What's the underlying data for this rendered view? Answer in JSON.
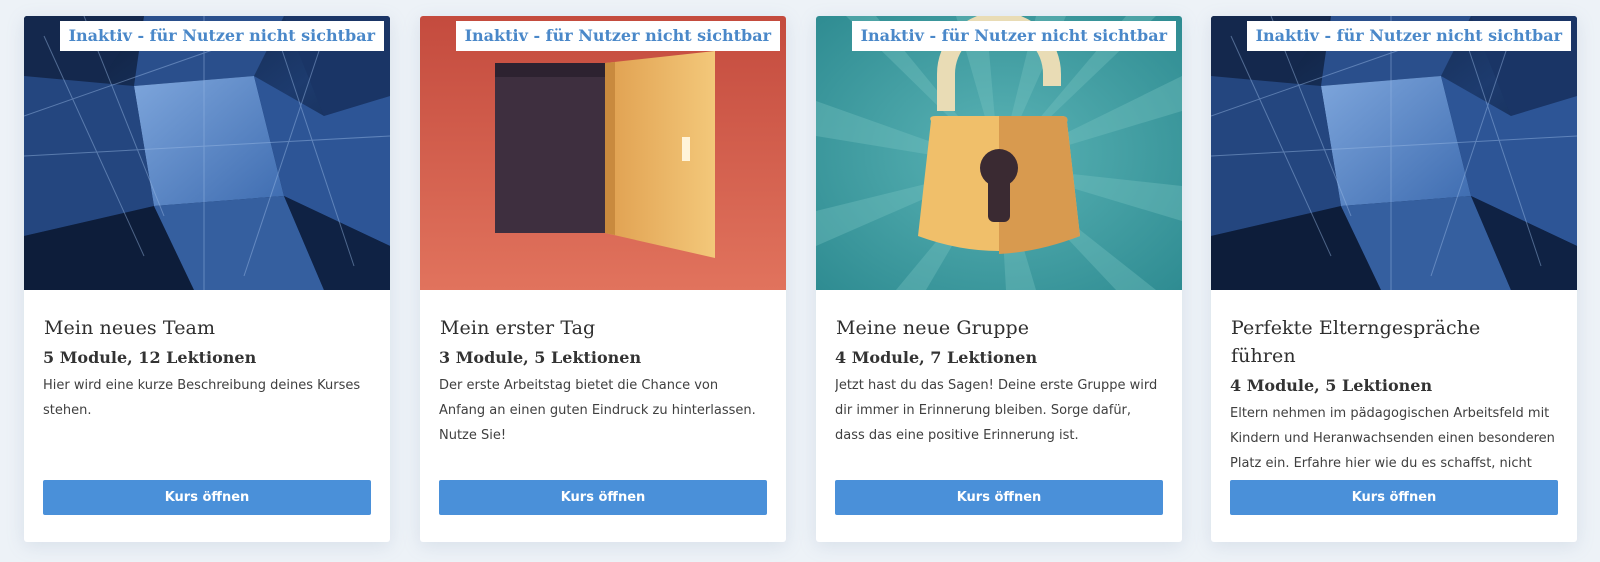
{
  "colors": {
    "accent": "#4a90d9",
    "badge_text": "#4a88c9",
    "background": "#edf2f7"
  },
  "courses": [
    {
      "image_name": "glass-building-image",
      "status": "Inaktiv - für Nutzer nicht sichtbar",
      "title": "Mein neues Team",
      "meta": "5 Module, 12 Lektionen",
      "description": "Hier wird eine kurze Beschreibung deines Kurses stehen.",
      "button_label": "Kurs öffnen"
    },
    {
      "image_name": "open-door-image",
      "status": "Inaktiv - für Nutzer nicht sichtbar",
      "title": "Mein erster Tag",
      "meta": "3 Module, 5 Lektionen",
      "description": "Der erste Arbeitstag bietet die Chance von Anfang an einen guten Eindruck zu hinterlassen. Nutze Sie!",
      "button_label": "Kurs öffnen"
    },
    {
      "image_name": "open-padlock-image",
      "status": "Inaktiv - für Nutzer nicht sichtbar",
      "title": "Meine neue Gruppe",
      "meta": "4 Module, 7 Lektionen",
      "description": "Jetzt hast du das Sagen! Deine erste Gruppe wird dir immer in Erinnerung bleiben. Sorge dafür, dass das eine positive Erinnerung ist.",
      "button_label": "Kurs öffnen"
    },
    {
      "image_name": "glass-building-image",
      "status": "Inaktiv - für Nutzer nicht sichtbar",
      "title": "Perfekte Elterngespräche führen",
      "meta": "4 Module, 5 Lektionen",
      "description": "Eltern nehmen im pädagogischen Arbeitsfeld mit Kindern und Heranwachsenden einen besonderen Platz ein. Erfahre hier wie du es schaffst, nicht",
      "button_label": "Kurs öffnen"
    }
  ]
}
